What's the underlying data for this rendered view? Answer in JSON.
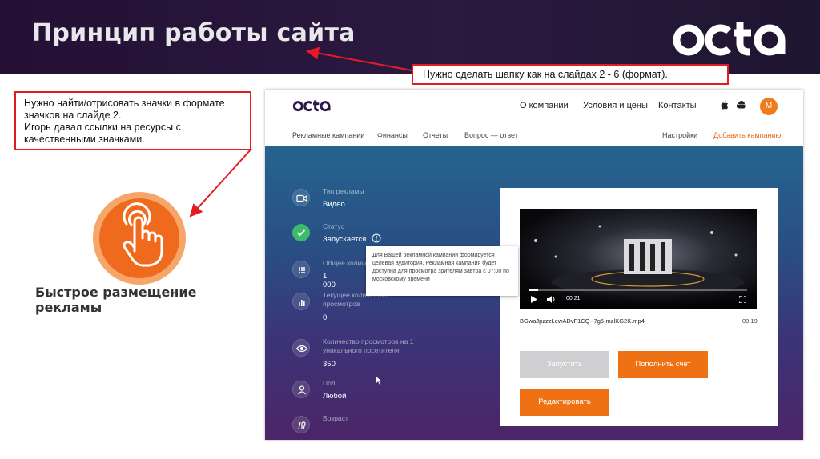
{
  "slide": {
    "title": "Принцип работы сайта",
    "logo_text": "octa"
  },
  "notes": {
    "header_note": "Нужно сделать шапку как на слайдах 2 - 6 (формат).",
    "icons_note_lines": [
      "Нужно найти/отрисовать значки в формате",
      "значков на слайде 2.",
      "Игорь давал ссылки на ресурсы с",
      "качественными значками."
    ]
  },
  "feature": {
    "icon": "tap-hand-icon",
    "caption": "Быстрое размещение рекламы"
  },
  "mockup": {
    "logo_text": "octa",
    "top_nav": [
      "О компании",
      "Условия и цены",
      "Контакты"
    ],
    "store_icons": [
      "apple-icon",
      "android-icon"
    ],
    "avatar_letter": "М",
    "sub_nav": [
      "Рекламные кампании",
      "Финансы",
      "Отчеты",
      "Вопрос — ответ"
    ],
    "settings_label": "Настройки",
    "add_campaign_label": "Добавить кампанию",
    "stats": [
      {
        "icon": "video-camera-icon",
        "label": "Тип рекламы",
        "value": "Видео"
      },
      {
        "icon": "check-icon",
        "label": "Статус",
        "value": "Запускается"
      },
      {
        "icon": "grid-icon",
        "label": "Общее количество",
        "value": "1 000"
      },
      {
        "icon": "bar-chart-icon",
        "label": "Текущее количество просмотров",
        "value": "0"
      },
      {
        "icon": "eye-icon",
        "label": "Количество просмотров на 1 уникального посетителя",
        "value": "350"
      },
      {
        "icon": "person-icon",
        "label": "Пол",
        "value": "Любой"
      },
      {
        "icon": "age-icon",
        "label": "Возраст",
        "value": ""
      }
    ],
    "tooltip_text": "Для Вашей рекламной кампании формируется целевая аудитория. Рекламная кампания будет доступна для просмотра зрителям завтра с 07:00 по московскому времени",
    "video": {
      "current_time": "00:21",
      "progress": 0.04,
      "file_name": "BGwaJpzzzLewADvF1CQ--7g5-mzlKG2K.mp4",
      "duration": "00:19"
    },
    "buttons": {
      "start": "Запустить",
      "topup": "Пополнить счет",
      "edit": "Редактировать"
    }
  },
  "colors": {
    "accent_orange": "#ee7213",
    "note_border": "#e11c24",
    "status_green": "#3dbb6c"
  }
}
